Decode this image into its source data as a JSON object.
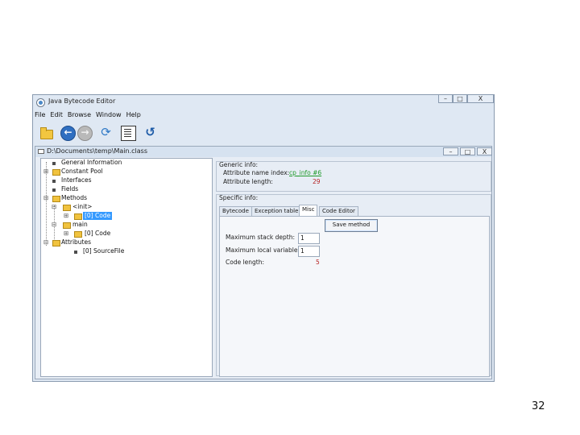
{
  "window": {
    "title": "Java Bytecode Editor",
    "controls": [
      "–",
      "□",
      "X"
    ]
  },
  "menu": [
    "File",
    "Edit",
    "Browse",
    "Window",
    "Help"
  ],
  "toolbar": {
    "icons": [
      "open-folder-icon",
      "back-arrow-icon",
      "forward-arrow-icon",
      "refresh-icon",
      "document-icon",
      "undo-icon"
    ]
  },
  "internal_frame": {
    "path": "D:\\Documents\\temp\\Main.class",
    "controls": [
      "–",
      "□",
      "X"
    ]
  },
  "tree": {
    "items": [
      {
        "label": "General Information",
        "type": "leaf"
      },
      {
        "label": "Constant Pool",
        "type": "folder",
        "expander": "⊞"
      },
      {
        "label": "Interfaces",
        "type": "leaf"
      },
      {
        "label": "Fields",
        "type": "leaf"
      },
      {
        "label": "Methods",
        "type": "folder",
        "expander": "⊟"
      },
      {
        "label": "<init>",
        "type": "folder",
        "expander": "⊟"
      },
      {
        "label": "[0] Code",
        "type": "folder",
        "expander": "⊞",
        "selected": true
      },
      {
        "label": "main",
        "type": "folder",
        "expander": "⊟"
      },
      {
        "label": "[0] Code",
        "type": "folder",
        "expander": "⊞"
      },
      {
        "label": "Attributes",
        "type": "folder",
        "expander": "⊟"
      },
      {
        "label": "[0] SourceFile",
        "type": "leaf"
      }
    ]
  },
  "generic_info": {
    "heading": "Generic info:",
    "attr_name_index_label": "Attribute name index:",
    "attr_name_index_value": "cp_info #6",
    "attr_length_label": "Attribute length:",
    "attr_length_value": "29"
  },
  "specific_info": {
    "heading": "Specific info:",
    "tabs": [
      "Bytecode",
      "Exception table",
      "Misc",
      "Code Editor"
    ],
    "active_tab": "Misc",
    "save_button": "Save method",
    "max_stack_label": "Maximum stack depth:",
    "max_stack_value": "1",
    "max_locals_label": "Maximum local variables:",
    "max_locals_value": "1",
    "code_length_label": "Code length:",
    "code_length_value": "5"
  },
  "slide_number": "32",
  "colors": {
    "selection": "#3399ff",
    "link": "#1f9a2a",
    "value": "#b52222"
  }
}
